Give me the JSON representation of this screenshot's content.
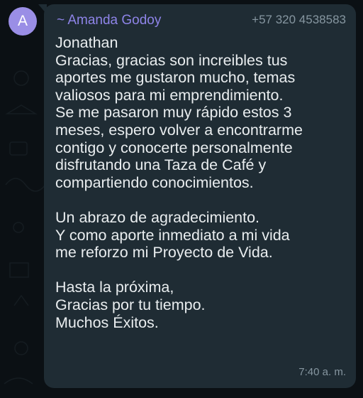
{
  "chat": {
    "avatar_initial": "A",
    "sender_name": "~ Amanda Godoy",
    "sender_phone": "+57 320 4538583",
    "timestamp": "7:40 a. m.",
    "lines": [
      "Jonathan",
      "Gracias, gracias son increibles tus",
      "aportes me gustaron mucho, temas",
      "valiosos para mi emprendimiento.",
      "Se me pasaron muy rápido estos 3",
      "meses, espero volver a encontrarme",
      "contigo y conocerte personalmente",
      "disfrutando una Taza de Café y",
      "compartiendo conocimientos.",
      "",
      "Un abrazo de agradecimiento.",
      "Y como aporte inmediato a mi vida",
      "me reforzo mi Proyecto de Vida.",
      "",
      "Hasta la próxima,",
      "Gracias por tu tiempo.",
      "Muchos Éxitos."
    ]
  },
  "colors": {
    "background": "#0b1014",
    "bubble": "#1f2c34",
    "avatar": "#9a8ee6",
    "sender_name": "#8e84e8",
    "meta_text": "#8696a0",
    "message_text": "#e9edef"
  },
  "icons": {
    "wallpaper": "doodle-pattern"
  }
}
